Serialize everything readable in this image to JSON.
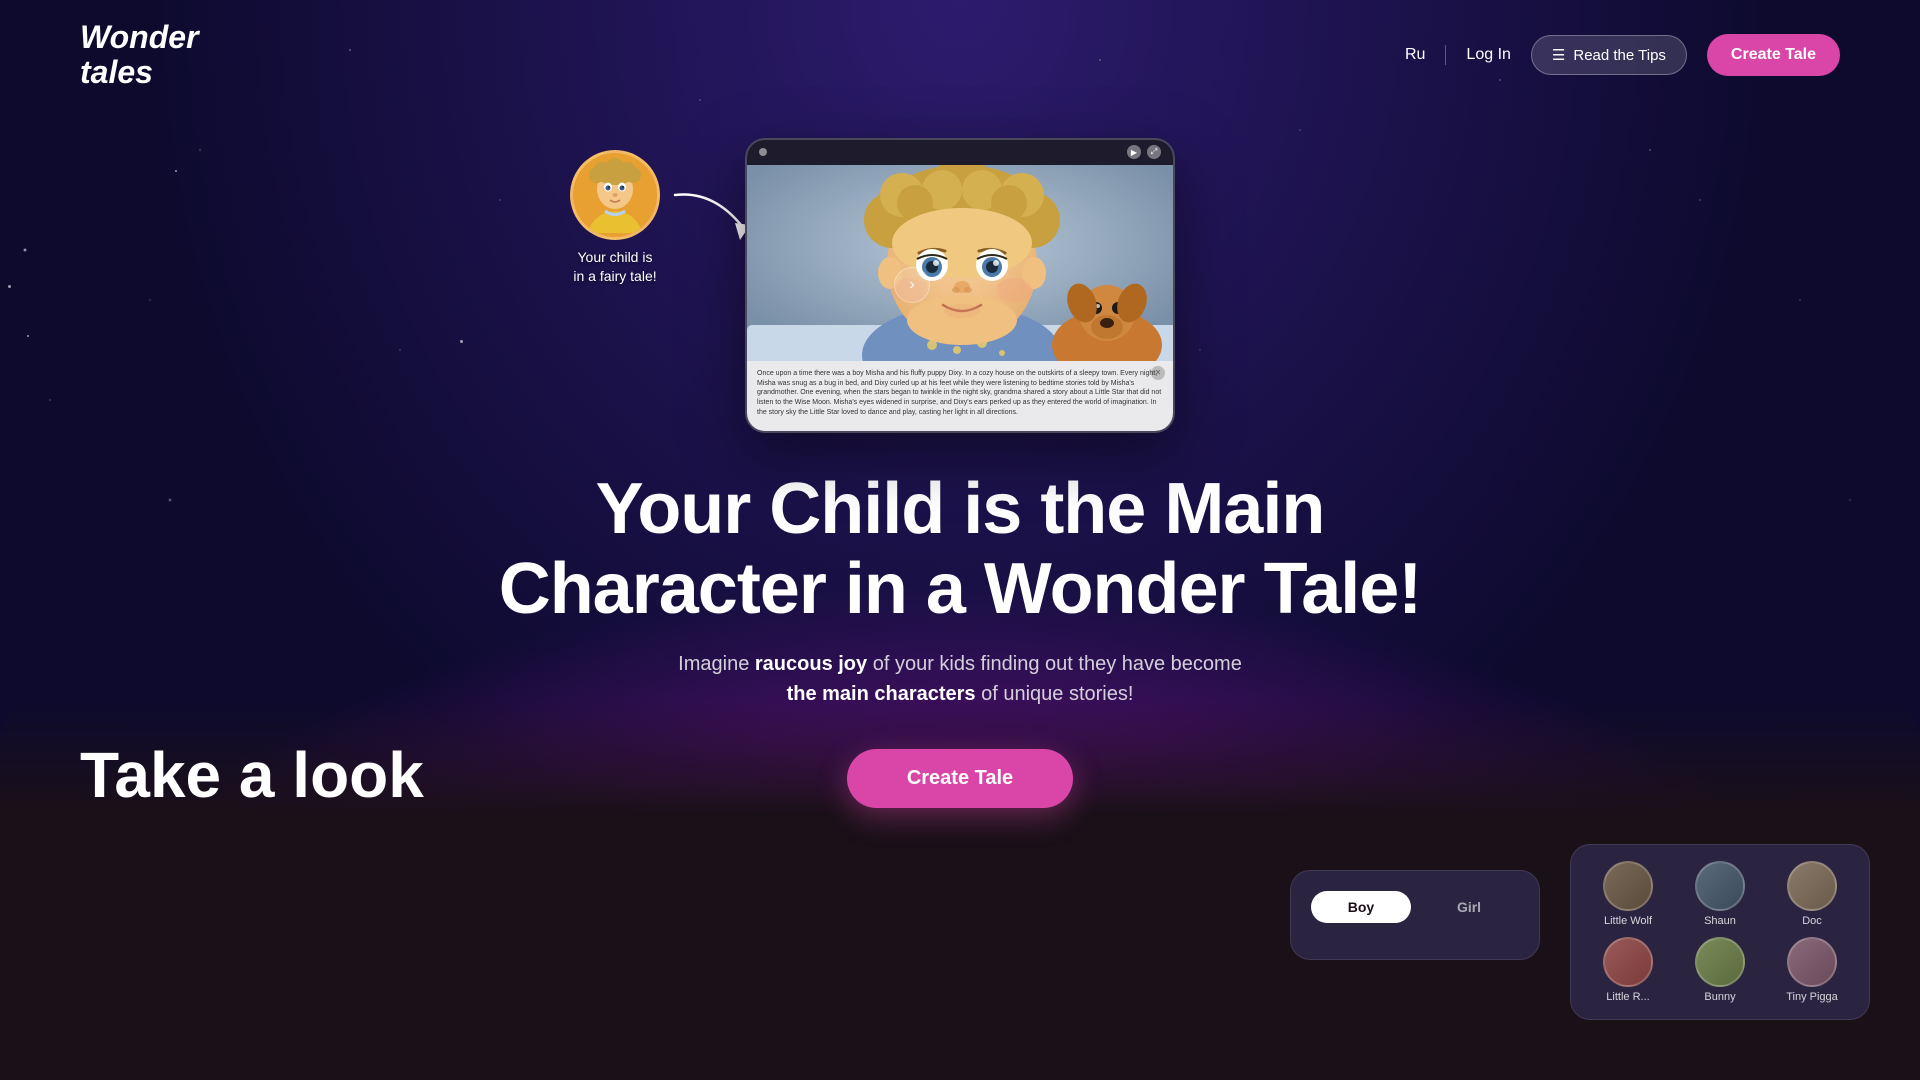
{
  "nav": {
    "logo_line1": "Wonder",
    "logo_line2": "tales",
    "lang": "Ru",
    "login": "Log In",
    "tips_icon": "☰",
    "tips_label": "Read the Tips",
    "create_label": "Create Tale"
  },
  "hero": {
    "heading_line1": "Your Child is the Main",
    "heading_line2": "Character in a Wonder Tale!",
    "subtext_prefix": "Imagine ",
    "subtext_bold": "raucous joy",
    "subtext_middle": " of your kids finding out they have become",
    "subtext_newline_bold": "the main characters",
    "subtext_suffix": " of unique stories!",
    "cta_label": "Create Tale"
  },
  "child_avatar": {
    "label_line1": "Your child is",
    "label_line2": "in a fairy tale!"
  },
  "tablet": {
    "story_text": "Once upon a time there was a boy Misha and his fluffy puppy Dixy. In a cozy house on the outskirts of a sleepy town. Every night, Misha was snug as a bug in bed, and Dixy curled up at his feet while they were listening to bedtime stories told by Misha's grandmother. One evening, when the stars began to twinkle in the night sky, grandma shared a story about a Little Star that did not listen to the Wise Moon. Misha's eyes widened in surprise, and Dixy's ears perked up as they entered the world of imagination. In the story sky the Little Star loved to dance and play, casting her light in all directions."
  },
  "nav_arrows": {
    "left": "‹",
    "right": "›"
  },
  "bottom": {
    "text_line1": "Take a look"
  },
  "character_tabs": {
    "boy_label": "Boy",
    "girl_label": "Girl"
  },
  "characters": [
    {
      "name": "Little Wolf",
      "color": "#7a6a5a"
    },
    {
      "name": "Shaun",
      "color": "#5a6a7a"
    },
    {
      "name": "Doc",
      "color": "#8a7a6a"
    },
    {
      "name": "Little R...",
      "color": "#9a5a5a"
    },
    {
      "name": "Bunny",
      "color": "#7a8a5a"
    },
    {
      "name": "Tiny Pigga",
      "color": "#8a6a7a"
    }
  ],
  "colors": {
    "brand_pink": "#d946a8",
    "bg_dark": "#0d0a2e",
    "bg_purple": "#2d1b6e",
    "nav_glass": "rgba(255,255,255,0.15)",
    "bottom_dark": "#1a1018"
  }
}
